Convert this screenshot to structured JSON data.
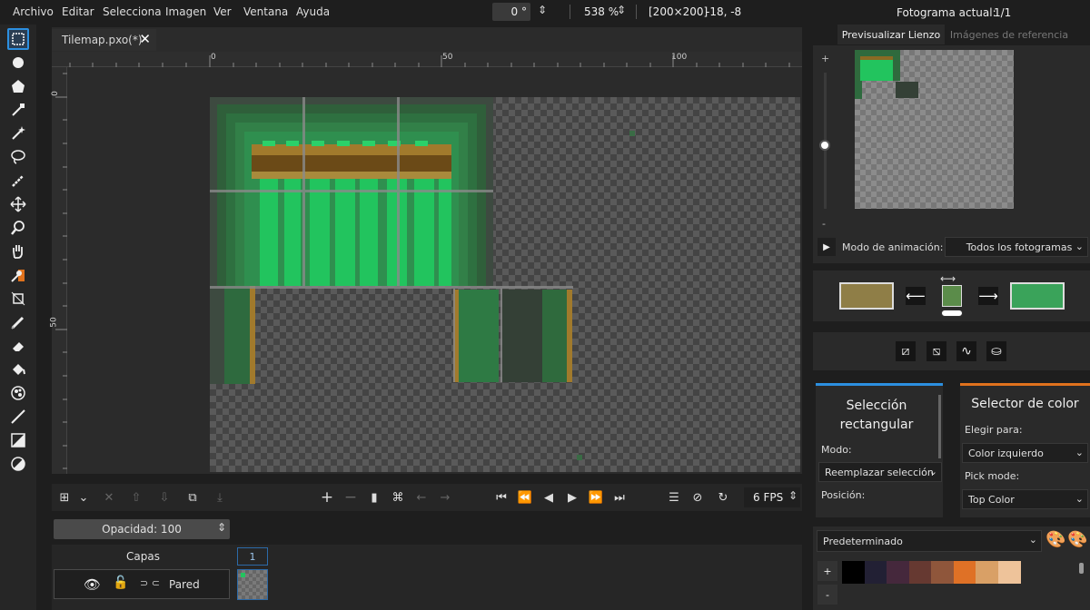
{
  "menu": {
    "items": [
      "Archivo",
      "Editar",
      "Selecciona",
      "Imagen",
      "Ver",
      "Ventana",
      "Ayuda"
    ],
    "rotation": "0 °",
    "zoom": "538 %",
    "size": "[200×200]",
    "cursor": "-18, -8",
    "frame_label": "Fotograma actual:",
    "frame_value": "1/1"
  },
  "tab": {
    "title": "Tilemap.pxo(*)"
  },
  "ruler": {
    "top_labels": [
      "0",
      "50",
      "100"
    ],
    "left_labels": [
      "0",
      "50"
    ]
  },
  "bottom": {
    "fps": "6 FPS",
    "opacity": "Opacidad: 100",
    "layers_title": "Capas",
    "frame_number": "1",
    "layer_name": "Pared"
  },
  "preview": {
    "tab_canvas": "Previsualizar Lienzo",
    "tab_refs": "Imágenes de referencia",
    "zoom_plus": "+",
    "zoom_minus": "-",
    "anim_label": "Modo de animación:",
    "anim_value": "Todos los fotogramas"
  },
  "colors": {
    "left": "#8f7e47",
    "center": "#5b8c4a",
    "right": "#3aa35a",
    "accent_blue": "#2c8fe0",
    "accent_orange": "#e0721d"
  },
  "tool_options": {
    "title": "Selección rectangular",
    "mode_label": "Modo:",
    "mode_value": "Reemplazar selección",
    "pos_label": "Posición:"
  },
  "picker": {
    "title": "Selector de color",
    "choose_label": "Elegir para:",
    "choose_value": "Color izquierdo",
    "pick_label": "Pick mode:",
    "pick_value": "Top Color"
  },
  "palette": {
    "name": "Predeterminado",
    "add": "+",
    "remove": "-",
    "swatches": [
      "#000000",
      "#222034",
      "#45283c",
      "#663931",
      "#8f563b",
      "#df7126",
      "#d9a066",
      "#eec39a"
    ]
  }
}
